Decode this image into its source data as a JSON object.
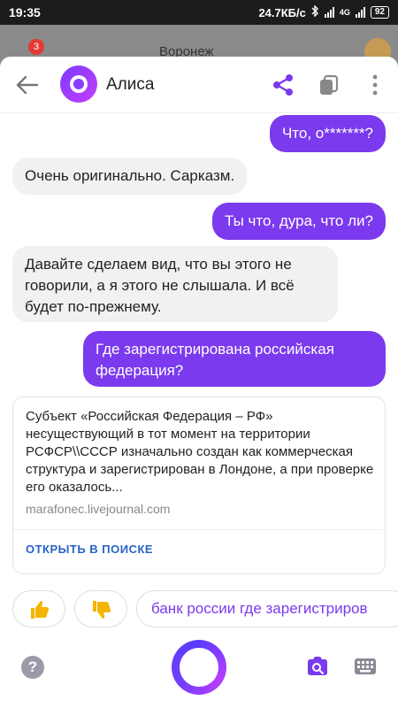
{
  "status_bar": {
    "time": "19:35",
    "net_speed": "24.7КБ/с",
    "network": "4G",
    "battery": "92"
  },
  "background_app": {
    "badge_count": "3",
    "city": "Воронеж"
  },
  "header": {
    "title": "Алиса"
  },
  "messages": [
    {
      "role": "user",
      "text": "Что, о*******?"
    },
    {
      "role": "bot",
      "text": "Очень оригинально. Сарказм."
    },
    {
      "role": "user",
      "text": "Ты что, дура, что ли?"
    },
    {
      "role": "bot",
      "text": "Давайте сделаем вид, что вы этого не говорили, а я этого не слышала. И всё будет по-прежнему."
    },
    {
      "role": "user",
      "text": "Где зарегистрирована российская федерация?"
    }
  ],
  "search_card": {
    "snippet": "Субъект «Российская Федерация – РФ» несуществующий в тот момент на территории РСФСР\\\\СССР изначально создан как коммерческая структура и зарегистрирован в Лондоне, а при проверке его оказалось...",
    "source": "marafonec.livejournal.com",
    "open_label": "ОТКРЫТЬ В ПОИСКЕ"
  },
  "suggestions": {
    "like_icon": "thumbs-up-icon",
    "dislike_icon": "thumbs-down-icon",
    "query": "банк россии где зарегистриров"
  },
  "colors": {
    "accent": "#7b3aed",
    "bot_bubble": "#f1f1f3",
    "link": "#2664c7"
  }
}
